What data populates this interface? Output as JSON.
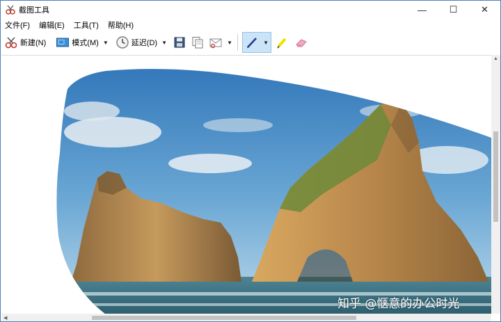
{
  "window": {
    "title": "截图工具",
    "minimize_glyph": "—",
    "maximize_glyph": "☐",
    "close_glyph": "✕"
  },
  "menu": {
    "items": [
      "文件(F)",
      "编辑(E)",
      "工具(T)",
      "帮助(H)"
    ]
  },
  "toolbar": {
    "new_label": "新建(N)",
    "mode_label": "模式(M)",
    "delay_label": "延迟(D)",
    "icons": [
      "scissors-icon",
      "mode-icon",
      "clock-icon",
      "save-icon",
      "copy-icon",
      "send-icon",
      "pen-icon",
      "highlighter-icon",
      "eraser-icon"
    ]
  },
  "canvas": {
    "watermark": "知乎 @惬意的办公时光"
  },
  "colors": {
    "sky_top": "#2f74b8",
    "sky_bottom": "#bcd9ea",
    "rock": "#b98a4e",
    "sea": "#3e6f7c",
    "pen_group_bg": "#cce4f7"
  }
}
